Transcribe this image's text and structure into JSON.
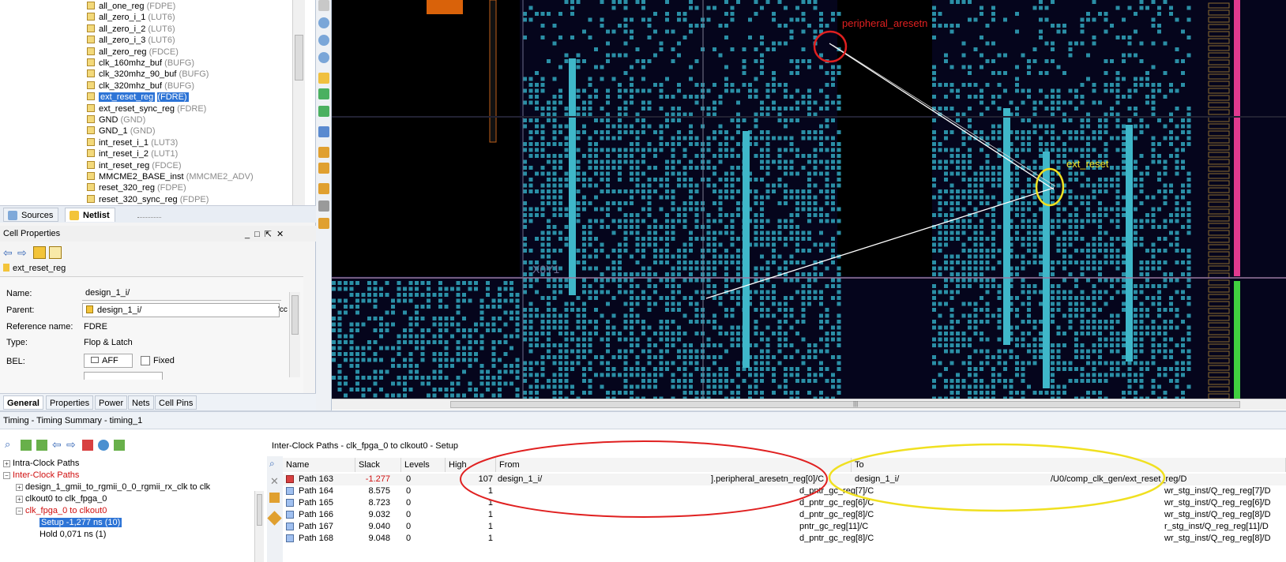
{
  "netlist": {
    "items": [
      {
        "name": "all_one_reg",
        "type": "(FDPE)"
      },
      {
        "name": "all_zero_i_1",
        "type": "(LUT6)"
      },
      {
        "name": "all_zero_i_2",
        "type": "(LUT6)"
      },
      {
        "name": "all_zero_i_3",
        "type": "(LUT6)"
      },
      {
        "name": "all_zero_reg",
        "type": "(FDCE)"
      },
      {
        "name": "clk_160mhz_buf",
        "type": "(BUFG)"
      },
      {
        "name": "clk_320mhz_90_buf",
        "type": "(BUFG)"
      },
      {
        "name": "clk_320mhz_buf",
        "type": "(BUFG)"
      },
      {
        "name": "ext_reset_reg",
        "type": "(FDRE)"
      },
      {
        "name": "ext_reset_sync_reg",
        "type": "(FDRE)"
      },
      {
        "name": "GND",
        "type": "(GND)"
      },
      {
        "name": "GND_1",
        "type": "(GND)"
      },
      {
        "name": "int_reset_i_1",
        "type": "(LUT3)"
      },
      {
        "name": "int_reset_i_2",
        "type": "(LUT1)"
      },
      {
        "name": "int_reset_reg",
        "type": "(FDCE)"
      },
      {
        "name": "MMCME2_BASE_inst",
        "type": "(MMCME2_ADV)"
      },
      {
        "name": "reset_320_reg",
        "type": "(FDPE)"
      },
      {
        "name": "reset_320_sync_reg",
        "type": "(FDPE)"
      }
    ],
    "tabs": [
      "Sources",
      "Netlist"
    ]
  },
  "cell_properties": {
    "title": "Cell Properties",
    "cell_name": "ext_reset_reg",
    "labels": {
      "name": "Name:",
      "parent": "Parent:",
      "ref": "Reference name:",
      "type": "Type:",
      "bel": "BEL:"
    },
    "name_value": "design_1_i/",
    "parent_value": "design_1_i/",
    "parent_suffix": "'cc",
    "ref_value": "FDRE",
    "type_value": "Flop & Latch",
    "bel_value": "AFF",
    "fixed_label": "Fixed",
    "tabs": [
      "General",
      "Properties",
      "Power",
      "Nets",
      "Cell Pins"
    ]
  },
  "device": {
    "annotation_red": "peripheral_aresetn",
    "annotation_yellow": "ext_reset",
    "tile_label_1": "X0Y1",
    "colors": {
      "bg": "#05051c",
      "cell": "#2a8fa6",
      "cell_hi": "#3fb7c9",
      "red": "#e02020",
      "yellow": "#f0e020"
    }
  },
  "timing": {
    "header": "Timing - Timing Summary - timing_1",
    "panel_title": "Inter-Clock Paths - clk_fpga_0 to clkout0 - Setup",
    "tree": [
      {
        "label": "Intra-Clock Paths",
        "red": false
      },
      {
        "label": "Inter-Clock Paths",
        "red": true
      },
      {
        "label": "design_1_gmii_to_rgmii_0_0_rgmii_rx_clk to clk",
        "red": false
      },
      {
        "label": "clkout0 to clk_fpga_0",
        "red": false
      },
      {
        "label": "clk_fpga_0 to clkout0",
        "red": true
      },
      {
        "label": "Setup -1,277 ns (10)",
        "red": true
      },
      {
        "label": "Hold 0,071 ns (1)",
        "red": false
      }
    ],
    "columns": [
      "Name",
      "Slack",
      "Levels",
      "High Fanout",
      "From",
      "To"
    ],
    "rows": [
      {
        "name": "Path 163",
        "slack": "-1.277",
        "levels": "0",
        "fanout": "107",
        "from_a": "design_1_i/",
        "from_b": "].peripheral_aresetn_reg[0]/C",
        "to_a": "design_1_i/",
        "to_b": "/U0/comp_clk_gen/ext_reset_reg/D",
        "bad": true
      },
      {
        "name": "Path 164",
        "slack": "8.575",
        "levels": "0",
        "fanout": "1",
        "from_a": "",
        "from_b": "d_pntr_gc_reg[7]/C",
        "to_a": "",
        "to_b": "wr_stg_inst/Q_reg_reg[7]/D",
        "bad": false
      },
      {
        "name": "Path 165",
        "slack": "8.723",
        "levels": "0",
        "fanout": "1",
        "from_a": "",
        "from_b": "d_pntr_gc_reg[6]/C",
        "to_a": "",
        "to_b": "wr_stg_inst/Q_reg_reg[6]/D",
        "bad": false
      },
      {
        "name": "Path 166",
        "slack": "9.032",
        "levels": "0",
        "fanout": "1",
        "from_a": "",
        "from_b": "d_pntr_gc_reg[8]/C",
        "to_a": "",
        "to_b": "wr_stg_inst/Q_reg_reg[8]/D",
        "bad": false
      },
      {
        "name": "Path 167",
        "slack": "9.040",
        "levels": "0",
        "fanout": "1",
        "from_a": "",
        "from_b": "pntr_gc_reg[11]/C",
        "to_a": "",
        "to_b": "r_stg_inst/Q_reg_reg[11]/D",
        "bad": false
      },
      {
        "name": "Path 168",
        "slack": "9.048",
        "levels": "0",
        "fanout": "1",
        "from_a": "",
        "from_b": "d_pntr_gc_reg[8]/C",
        "to_a": "",
        "to_b": "wr_stg_inst/Q_reg_reg[8]/D",
        "bad": false
      }
    ]
  }
}
